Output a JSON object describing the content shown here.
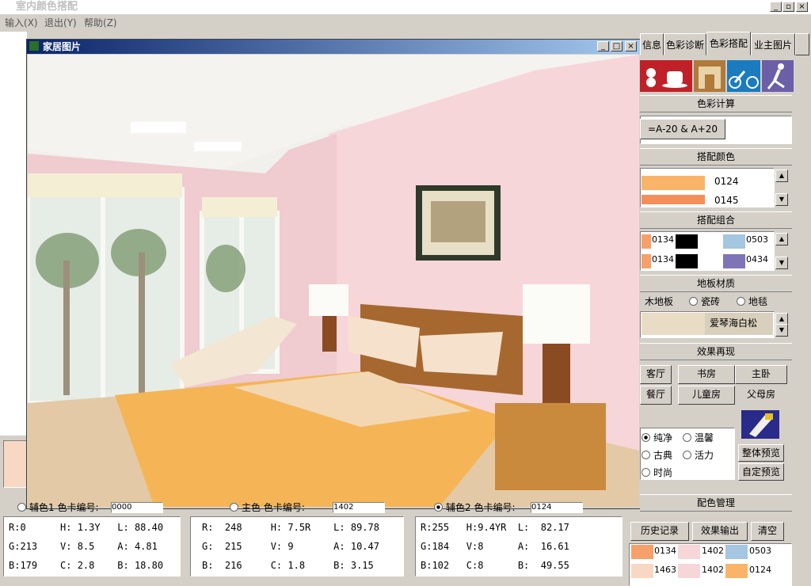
{
  "app": {
    "title": "室内颜色搭配",
    "controls": [
      "_",
      "▫",
      "×"
    ]
  },
  "menu": [
    {
      "label": "输入",
      "key": "(X)"
    },
    {
      "label": "退出",
      "key": "(Y)"
    },
    {
      "label": "帮助",
      "key": "(Z)"
    }
  ],
  "child_window": {
    "title": "家居图片",
    "controls": [
      "_",
      "□",
      "×"
    ]
  },
  "tabs": [
    "信息",
    "色彩诊断",
    "色彩搭配",
    "业主图片"
  ],
  "panels": {
    "calc_title": "色彩计算",
    "calc_button": "=A-20 & A+20",
    "match_color_title": "搭配颜色",
    "match_colors": [
      {
        "code": "0124",
        "color": "#f9b46a"
      },
      {
        "code": "0145",
        "color": "#f48f5a"
      }
    ],
    "combo_title": "搭配组合",
    "combos": [
      [
        {
          "code": "0134",
          "color": "#f6a06a"
        },
        {
          "code": "",
          "color": "#000000"
        },
        {
          "code": "0503",
          "color": "#a5c6e0"
        }
      ],
      [
        {
          "code": "0134",
          "color": "#f6a06a"
        },
        {
          "code": "",
          "color": "#000000"
        },
        {
          "code": "0434",
          "color": "#7f74b8"
        }
      ]
    ],
    "floor_title": "地板材质",
    "floor_options": [
      "木地板",
      "瓷砖",
      "地毯"
    ],
    "floor_material": "爱琴海白松",
    "effect_title": "效果再现",
    "rooms": [
      "客厅",
      "书房",
      "主卧",
      "餐厅",
      "儿童房",
      "父母房"
    ],
    "styles": [
      "纯净",
      "温馨",
      "古典",
      "活力",
      "时尚"
    ],
    "preview_buttons": [
      "整体预览",
      "自定预览"
    ],
    "manage_title": "配色管理",
    "manage_buttons": [
      "历史记录",
      "效果输出",
      "清空"
    ],
    "history": [
      [
        {
          "code": "0134",
          "color": "#f6a06a"
        },
        {
          "code": "1402",
          "color": "#f7d6d9"
        },
        {
          "code": "0503",
          "color": "#a5c6e0"
        }
      ],
      [
        {
          "code": "1463",
          "color": "#f8d8c2"
        },
        {
          "code": "1402",
          "color": "#f7d6d9"
        },
        {
          "code": "0124",
          "color": "#f9b46a"
        }
      ]
    ]
  },
  "color_labels": [
    {
      "label": "辅色1 色卡编号:",
      "code": "0000"
    },
    {
      "label": "主色 色卡编号:",
      "code": "1402"
    },
    {
      "label": "辅色2 色卡编号:",
      "code": "0124"
    }
  ],
  "color_info": [
    {
      "rows": [
        "R:0      H: 1.3Y   L: 88.40",
        "G:213    V: 8.5    A: 4.81",
        "B:179    C: 2.8    B: 18.80"
      ]
    },
    {
      "rows": [
        "R:  248     H: 7.5R    L: 89.78",
        "G:  215     V: 9       A: 10.47",
        "B:  216     C: 1.8     B: 3.15"
      ]
    },
    {
      "rows": [
        "R:255   H:9.4YR  L:  82.17",
        "G:184   V:8      A:  16.61",
        "B:102   C:8      B:  49.55"
      ]
    }
  ],
  "colors": {
    "title_bar": "#0a246a",
    "accent_swatch": "#f8d8c2",
    "wall_pink": "#f7d6d9"
  }
}
